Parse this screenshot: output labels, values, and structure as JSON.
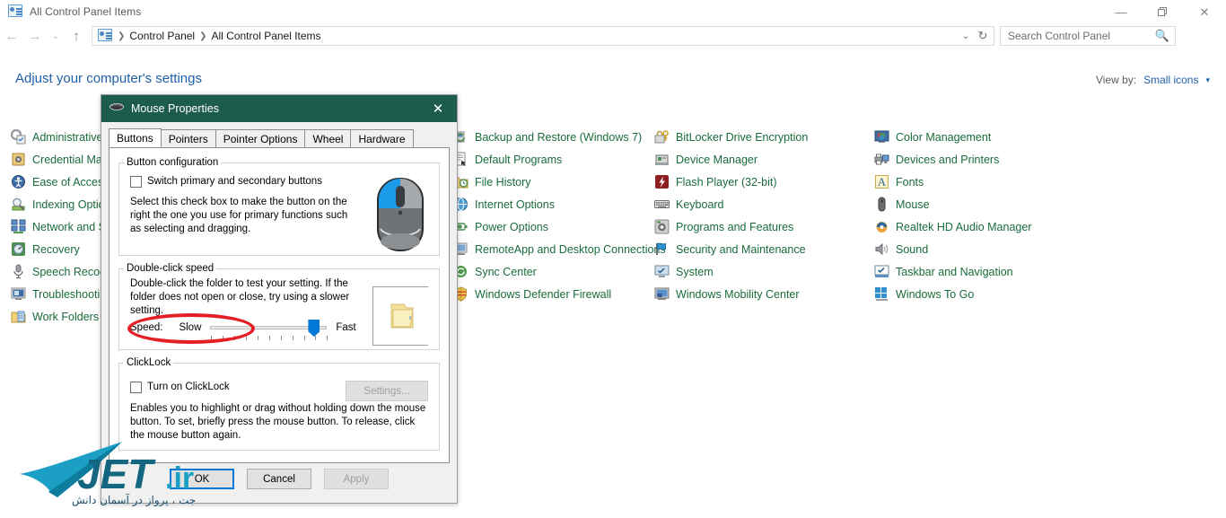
{
  "window": {
    "title": "All Control Panel Items",
    "title_icon": "control-panel-icon",
    "minimize": "—",
    "maximize": "❐",
    "close": "✕"
  },
  "nav": {
    "back": "←",
    "forward": "→",
    "recent": "⌄",
    "up": "↑",
    "breadcrumbs": [
      "Control Panel",
      "All Control Panel Items"
    ],
    "separator": "❯",
    "dropdown": "⌄",
    "refresh": "↻"
  },
  "search": {
    "placeholder": "Search Control Panel",
    "value": "",
    "icon": "search-icon"
  },
  "header": {
    "title": "Adjust your computer's settings",
    "view_by_label": "View by:",
    "view_by_value": "Small icons",
    "caret": "▾"
  },
  "items": {
    "column1": [
      {
        "label": "Administrative Tools",
        "icon": "administrative-tools-icon"
      },
      {
        "label": "Credential Manager",
        "icon": "credential-manager-icon"
      },
      {
        "label": "Ease of Access Center",
        "icon": "ease-of-access-icon"
      },
      {
        "label": "Indexing Options",
        "icon": "indexing-options-icon"
      },
      {
        "label": "Network and Sharing Center",
        "icon": "network-sharing-icon"
      },
      {
        "label": "Recovery",
        "icon": "recovery-icon"
      },
      {
        "label": "Speech Recognition",
        "icon": "speech-recognition-icon"
      },
      {
        "label": "Troubleshooting",
        "icon": "troubleshooting-icon"
      },
      {
        "label": "Work Folders",
        "icon": "work-folders-icon"
      }
    ],
    "column2": [
      {
        "label": "Backup and Restore (Windows 7)",
        "icon": "backup-restore-icon"
      },
      {
        "label": "Default Programs",
        "icon": "default-programs-icon"
      },
      {
        "label": "File History",
        "icon": "file-history-icon"
      },
      {
        "label": "Internet Options",
        "icon": "internet-options-icon"
      },
      {
        "label": "Power Options",
        "icon": "power-options-icon"
      },
      {
        "label": "RemoteApp and Desktop Connections",
        "icon": "remoteapp-icon"
      },
      {
        "label": "Sync Center",
        "icon": "sync-center-icon"
      },
      {
        "label": "Windows Defender Firewall",
        "icon": "firewall-icon"
      }
    ],
    "column3": [
      {
        "label": "BitLocker Drive Encryption",
        "icon": "bitlocker-icon"
      },
      {
        "label": "Device Manager",
        "icon": "device-manager-icon"
      },
      {
        "label": "Flash Player (32-bit)",
        "icon": "flash-player-icon"
      },
      {
        "label": "Keyboard",
        "icon": "keyboard-icon"
      },
      {
        "label": "Programs and Features",
        "icon": "programs-features-icon"
      },
      {
        "label": "Security and Maintenance",
        "icon": "security-maintenance-icon"
      },
      {
        "label": "System",
        "icon": "system-icon"
      },
      {
        "label": "Windows Mobility Center",
        "icon": "mobility-center-icon"
      }
    ],
    "column4": [
      {
        "label": "Color Management",
        "icon": "color-management-icon"
      },
      {
        "label": "Devices and Printers",
        "icon": "devices-printers-icon"
      },
      {
        "label": "Fonts",
        "icon": "fonts-icon"
      },
      {
        "label": "Mouse",
        "icon": "mouse-icon"
      },
      {
        "label": "Realtek HD Audio Manager",
        "icon": "realtek-audio-icon"
      },
      {
        "label": "Sound",
        "icon": "sound-icon"
      },
      {
        "label": "Taskbar and Navigation",
        "icon": "taskbar-navigation-icon"
      },
      {
        "label": "Windows To Go",
        "icon": "windows-to-go-icon"
      }
    ]
  },
  "dialog": {
    "title": "Mouse Properties",
    "title_icon": "mouse-icon",
    "close": "✕",
    "titlebar_color": "#1c5c4c",
    "tabs": [
      {
        "label": "Buttons",
        "active": true
      },
      {
        "label": "Pointers",
        "active": false
      },
      {
        "label": "Pointer Options",
        "active": false
      },
      {
        "label": "Wheel",
        "active": false
      },
      {
        "label": "Hardware",
        "active": false
      }
    ],
    "button_configuration": {
      "legend": "Button configuration",
      "checkbox_label": "Switch primary and secondary buttons",
      "checked": false,
      "description": "Select this check box to make the button on the right the one you use for primary functions such as selecting and dragging.",
      "image": "mouse-illustration",
      "highlight_color": "#1b9ae8"
    },
    "double_click_speed": {
      "legend": "Double-click speed",
      "description": "Double-click the folder to test your setting. If the folder does not open or close, try using a slower setting.",
      "speed_label": "Speed:",
      "min_label": "Slow",
      "max_label": "Fast",
      "value_percent": 83,
      "test_icon": "folder-icon"
    },
    "clicklock": {
      "legend": "ClickLock",
      "checkbox_label": "Turn on ClickLock",
      "checked": false,
      "settings_button": "Settings...",
      "settings_enabled": false,
      "description": "Enables you to highlight or drag without holding down the mouse button. To set, briefly press the mouse button. To release, click the mouse button again.",
      "annotation": "red-ellipse-highlight",
      "annotation_color": "#e31e24"
    },
    "buttons": {
      "ok": "OK",
      "cancel": "Cancel",
      "apply": "Apply",
      "apply_enabled": false
    }
  },
  "watermark": {
    "brand": "JET",
    "tld": ".ir",
    "tagline": "جت ، پرواز در آسمان دانش",
    "color": "#1b9fc4"
  }
}
